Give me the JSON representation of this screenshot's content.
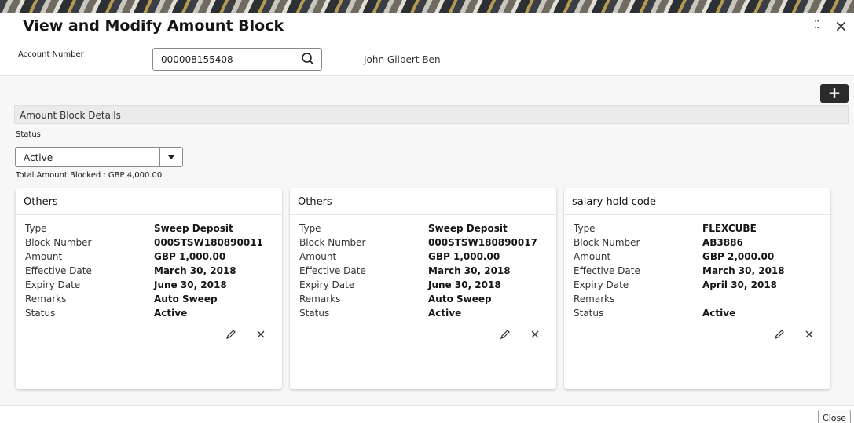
{
  "window": {
    "title": "View and Modify Amount Block",
    "minimize_glyph": "⁚⁚",
    "close_glyph": "×"
  },
  "account": {
    "label": "Account Number",
    "value": "000008155408",
    "holder_name": "John Gilbert Ben"
  },
  "toolbar": {
    "add_glyph": "+"
  },
  "section": {
    "title": "Amount Block Details",
    "status_label": "Status",
    "status_value": "Active",
    "total_blocked": "Total Amount Blocked : GBP 4,000.00"
  },
  "cards": [
    {
      "title": "Others",
      "rows": [
        {
          "key": "Type",
          "value": "Sweep Deposit"
        },
        {
          "key": "Block Number",
          "value": "000STSW180890011"
        },
        {
          "key": "Amount",
          "value": "GBP 1,000.00"
        },
        {
          "key": "Effective Date",
          "value": "March 30, 2018"
        },
        {
          "key": "Expiry Date",
          "value": "June 30, 2018"
        },
        {
          "key": "Remarks",
          "value": "Auto Sweep"
        },
        {
          "key": "Status",
          "value": "Active"
        }
      ]
    },
    {
      "title": "Others",
      "rows": [
        {
          "key": "Type",
          "value": "Sweep Deposit"
        },
        {
          "key": "Block Number",
          "value": "000STSW180890017"
        },
        {
          "key": "Amount",
          "value": "GBP 1,000.00"
        },
        {
          "key": "Effective Date",
          "value": "March 30, 2018"
        },
        {
          "key": "Expiry Date",
          "value": "June 30, 2018"
        },
        {
          "key": "Remarks",
          "value": "Auto Sweep"
        },
        {
          "key": "Status",
          "value": "Active"
        }
      ]
    },
    {
      "title": "salary hold code",
      "rows": [
        {
          "key": "Type",
          "value": "FLEXCUBE"
        },
        {
          "key": "Block Number",
          "value": "AB3886"
        },
        {
          "key": "Amount",
          "value": "GBP 2,000.00"
        },
        {
          "key": "Effective Date",
          "value": "March 30, 2018"
        },
        {
          "key": "Expiry Date",
          "value": "April 30, 2018"
        },
        {
          "key": "Remarks",
          "value": ""
        },
        {
          "key": "Status",
          "value": "Active"
        }
      ]
    }
  ],
  "footer": {
    "close_label": "Close"
  }
}
